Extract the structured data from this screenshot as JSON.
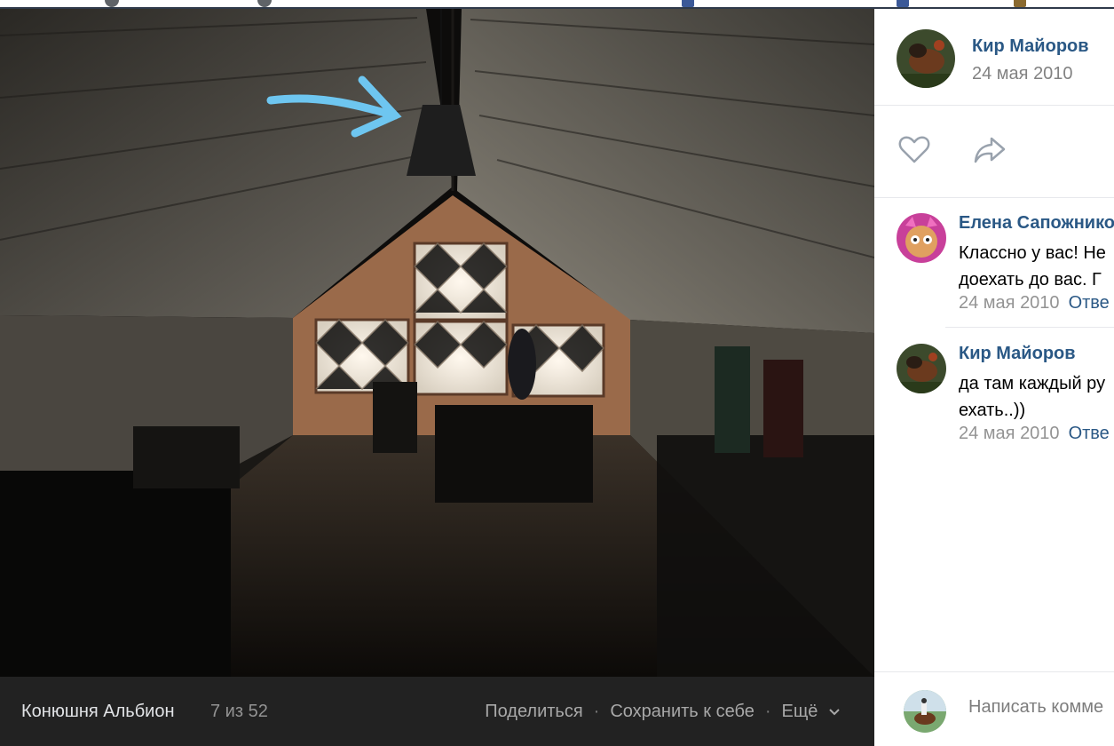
{
  "viewer": {
    "album_name": "Конюшня Альбион",
    "counter": "7 из 52",
    "actions": {
      "share": "Поделиться",
      "save": "Сохранить к себе",
      "more": "Ещё"
    },
    "icons": {
      "more": "chevron-down-icon",
      "annotation": "arrow-icon"
    },
    "colors": {
      "bottom_bar": "#222222",
      "annotation_arrow": "#6ec6f0"
    }
  },
  "post": {
    "author": "Кир Майоров",
    "date": "24 мая 2010",
    "icons": {
      "like": "heart-icon",
      "share": "share-arrow-icon"
    }
  },
  "comments": [
    {
      "author": "Елена Сапожнико",
      "lines": [
        "Классно у вас! Не",
        "доехать до вас. Г"
      ],
      "date": "24 мая 2010",
      "reply": "Отве"
    },
    {
      "author": "Кир Майоров",
      "lines": [
        "да там каждый ру",
        "ехать..))"
      ],
      "date": "24 мая 2010",
      "reply": "Отве"
    }
  ],
  "composer": {
    "placeholder": "Написать комме"
  },
  "colors": {
    "link": "#2a5885",
    "muted": "#939393"
  }
}
